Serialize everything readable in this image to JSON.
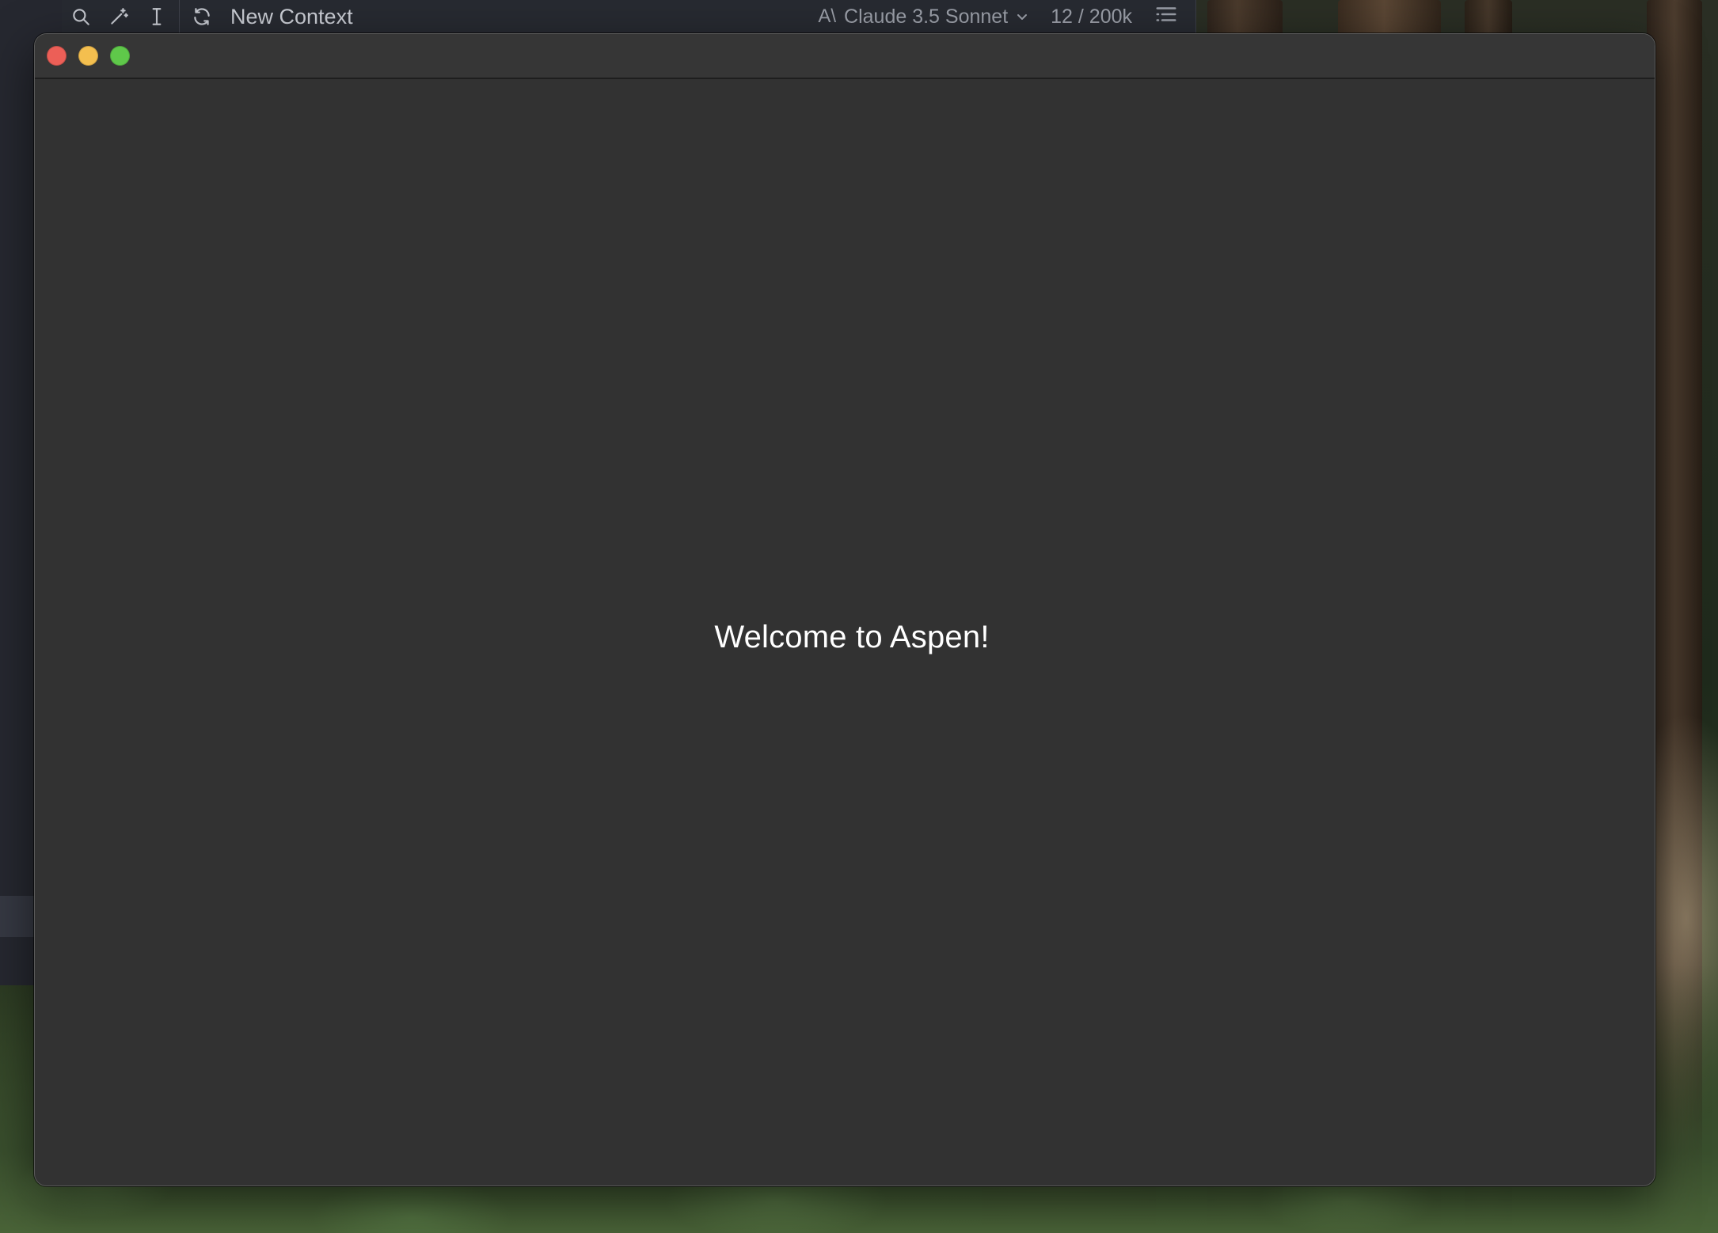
{
  "toolbar": {
    "icons": [
      "search-icon",
      "magic-wand-icon",
      "text-cursor-icon",
      "refresh-icon"
    ],
    "context_title": "New Context",
    "model_logo": "A\\",
    "model_name": "Claude 3.5 Sonnet",
    "token_count": "12 / 200k",
    "outline_icon": "outline-list-icon"
  },
  "window": {
    "controls": [
      "close",
      "minimize",
      "maximize"
    ],
    "colors": {
      "close": "#ec5f57",
      "minimize": "#f4bf4f",
      "maximize": "#5fc84a",
      "background": "#323232"
    }
  },
  "main": {
    "welcome_text": "Welcome to Aspen!"
  }
}
